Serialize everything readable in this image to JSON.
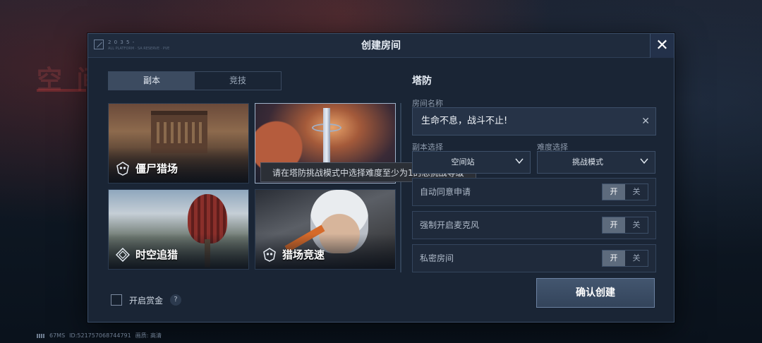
{
  "dialog": {
    "title": "创建房间",
    "close_icon": "close-icon",
    "logo_text": "2 0 3 5 -",
    "logo_sub": "ALL PLATFORM · SA RESERVE · PVE"
  },
  "tabs": [
    {
      "label": "副本",
      "active": true
    },
    {
      "label": "竞技",
      "active": false
    }
  ],
  "modes": [
    {
      "label": "僵尸猎场",
      "icon": "mask-icon",
      "selected": false
    },
    {
      "label": "",
      "icon": "",
      "selected": true
    },
    {
      "label": "时空追猎",
      "icon": "spiral-icon",
      "selected": false
    },
    {
      "label": "猎场竞速",
      "icon": "mask-icon",
      "selected": false
    }
  ],
  "tooltip": "请在塔防挑战模式中选择难度至少为1的总挑战等级",
  "bounty": {
    "label": "开启赏金",
    "help": "?"
  },
  "panel": {
    "title": "塔防",
    "room_name_label": "房间名称",
    "room_name_value": "生命不息，战斗不止!",
    "instance_label": "副本选择",
    "instance_value": "空间站",
    "difficulty_label": "难度选择",
    "difficulty_value": "挑战模式",
    "rows": [
      {
        "label": "自动同意申请",
        "on": "开",
        "off": "关"
      },
      {
        "label": "强制开启麦克风",
        "on": "开",
        "off": "关"
      },
      {
        "label": "私密房间",
        "on": "开",
        "off": "关"
      }
    ],
    "confirm": "确认创建"
  },
  "footer": {
    "ping": "67MS",
    "id": "ID:521757068744791",
    "quality": "画质: 高清"
  },
  "colors": {
    "accent": "#43566f",
    "panel_bg": "#1a2535"
  }
}
